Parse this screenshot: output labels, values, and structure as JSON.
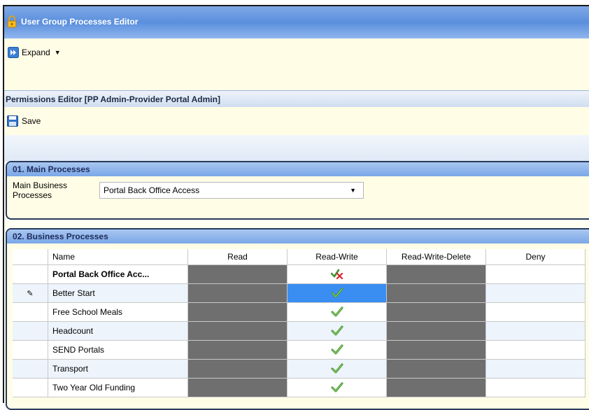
{
  "window": {
    "title": "User Group Processes Editor"
  },
  "toolbar": {
    "expand_label": "Expand",
    "save_label": "Save"
  },
  "permissions": {
    "title": "Permissions Editor [PP Admin-Provider Portal Admin]"
  },
  "main_processes": {
    "header": "01. Main Processes",
    "label": "Main Business Processes",
    "selected": "Portal Back Office Access"
  },
  "business_processes": {
    "header": "02. Business Processes",
    "columns": [
      "Name",
      "Read",
      "Read-Write",
      "Read-Write-Delete",
      "Deny"
    ],
    "rows": [
      {
        "name": "Portal Back Office Acc...",
        "read_write": "partial-icon",
        "bold": true
      },
      {
        "name": "Better Start",
        "read_write": "check-icon",
        "editing": true
      },
      {
        "name": "Free School Meals",
        "read_write": "check-icon"
      },
      {
        "name": "Headcount",
        "read_write": "check-icon"
      },
      {
        "name": "SEND Portals",
        "read_write": "check-icon"
      },
      {
        "name": "Transport",
        "read_write": "check-icon"
      },
      {
        "name": "Two Year Old Funding",
        "read_write": "check-icon"
      }
    ]
  },
  "colors": {
    "title_bar": "#5b8fdd",
    "disabled_cell": "#6f6f6f",
    "selected_cell": "#3a8ef2",
    "panel_bg": "#fffde6"
  }
}
